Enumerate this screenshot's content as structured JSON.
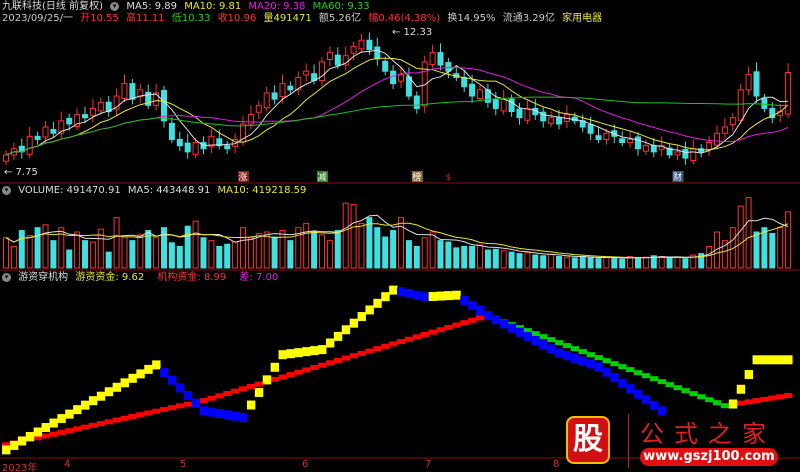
{
  "header": {
    "stock_name": "九联科技(日线 前复权)",
    "ma5": "MA5: 9.89",
    "ma10": "MA10: 9.81",
    "ma20": "MA20: 9.38",
    "ma60": "MA60: 9.33",
    "date": "2023/09/25/一",
    "open": "开10.55",
    "high": "高11.11",
    "low": "低10.33",
    "close": "收10.96",
    "volume": "量491471",
    "amount": "额5.26亿",
    "change": "幅0.46(4.38%)",
    "turnover": "换14.95%",
    "float": "流通3.29亿",
    "sector": "家用电器"
  },
  "main_chart": {
    "high_label": "12.33",
    "low_label": "7.75",
    "markers": [
      {
        "text": "涨",
        "color": "#8b1a1a",
        "idx": 30
      },
      {
        "text": "减",
        "color": "#2a8a2a",
        "idx": 40
      },
      {
        "text": "榜",
        "color": "#8a6a3a",
        "idx": 52
      },
      {
        "text": "$",
        "color": "#e02020",
        "idx": 56
      },
      {
        "text": "财",
        "color": "#3a5a8a",
        "idx": 85
      }
    ]
  },
  "volume_panel": {
    "title": "VOLUME: 491470.91",
    "ma5": "MA5: 443448.91",
    "ma10": "MA10: 419218.59"
  },
  "indicator_panel": {
    "name": "游资穿机构",
    "yz": "游资资金: 9.62",
    "jg": "机构资金: 8.99",
    "diff": "差: 7.00"
  },
  "x_axis": [
    "2023年",
    "4",
    "5",
    "6",
    "7",
    "8"
  ],
  "watermark": {
    "logo_char": "股",
    "name": "公式之家",
    "url": "www.gszj100.com"
  },
  "chart_data": {
    "type": "candlestick",
    "closes": [
      8.3,
      8.5,
      8.4,
      8.9,
      8.8,
      9.2,
      9.0,
      9.4,
      9.3,
      9.6,
      9.5,
      9.8,
      10.0,
      9.7,
      10.2,
      10.6,
      10.1,
      10.4,
      9.9,
      10.3,
      9.4,
      8.8,
      8.6,
      8.4,
      8.7,
      8.5,
      8.9,
      8.6,
      8.5,
      8.8,
      9.3,
      9.6,
      9.9,
      10.3,
      10.1,
      10.6,
      10.4,
      10.8,
      11.0,
      10.7,
      11.3,
      11.6,
      11.2,
      11.5,
      11.8,
      12.0,
      11.7,
      11.4,
      11.0,
      10.6,
      10.9,
      10.2,
      9.8,
      11.3,
      11.6,
      11.2,
      11.0,
      10.8,
      10.5,
      10.2,
      10.4,
      10.0,
      9.8,
      10.1,
      9.7,
      9.5,
      9.8,
      9.6,
      9.4,
      9.5,
      9.3,
      9.6,
      9.4,
      9.2,
      9.0,
      8.8,
      9.0,
      8.9,
      8.7,
      8.8,
      8.5,
      8.6,
      8.4,
      8.6,
      8.3,
      8.4,
      8.2,
      8.5,
      8.4,
      8.7,
      9.0,
      9.2,
      9.5,
      10.4,
      10.9,
      10.2,
      9.8,
      9.5,
      9.7,
      10.96
    ],
    "volumes": [
      420000,
      300000,
      520000,
      450000,
      560000,
      600000,
      380000,
      560000,
      250000,
      500000,
      380000,
      360000,
      540000,
      220000,
      700000,
      430000,
      380000,
      460000,
      520000,
      420000,
      560000,
      350000,
      300000,
      580000,
      650000,
      420000,
      380000,
      300000,
      330000,
      360000,
      560000,
      420000,
      480000,
      500000,
      430000,
      520000,
      380000,
      560000,
      620000,
      500000,
      460000,
      380000,
      520000,
      900000,
      880000,
      620000,
      700000,
      560000,
      430000,
      520000,
      700000,
      380000,
      300000,
      420000,
      500000,
      380000,
      360000,
      280000,
      300000,
      300000,
      320000,
      250000,
      260000,
      240000,
      220000,
      200000,
      210000,
      180000,
      170000,
      190000,
      160000,
      150000,
      140000,
      160000,
      150000,
      130000,
      150000,
      140000,
      120000,
      160000,
      140000,
      150000,
      170000,
      160000,
      140000,
      150000,
      130000,
      180000,
      200000,
      300000,
      500000,
      380000,
      560000,
      860000,
      980000,
      500000,
      560000,
      480000,
      560000,
      780000
    ],
    "price_range": [
      7.75,
      12.33
    ],
    "yz_keys": [
      [
        0,
        0.3
      ],
      [
        19,
        5.3
      ],
      [
        25,
        2.6
      ],
      [
        30,
        2.2
      ],
      [
        35,
        5.9
      ],
      [
        40,
        6.2
      ],
      [
        49,
        9.7
      ],
      [
        53,
        9.3
      ],
      [
        57,
        9.4
      ],
      [
        61,
        8.2
      ],
      [
        70,
        6.0
      ],
      [
        75,
        5.2
      ],
      [
        83,
        2.6
      ],
      [
        92,
        3.0
      ],
      [
        95,
        5.6
      ],
      [
        99,
        5.6
      ]
    ],
    "yz_hidden": [
      [
        84,
        91
      ]
    ],
    "jg_keys": [
      [
        0,
        0.6
      ],
      [
        25,
        3.2
      ],
      [
        61,
        8.2
      ],
      [
        91,
        2.9
      ],
      [
        99,
        3.5
      ]
    ],
    "series": [
      {
        "name": "游资资金",
        "up_color": "#ffff00",
        "down_color": "#0000ff"
      },
      {
        "name": "机构资金",
        "up_color": "#ff0000",
        "down_color": "#00d000"
      }
    ]
  }
}
